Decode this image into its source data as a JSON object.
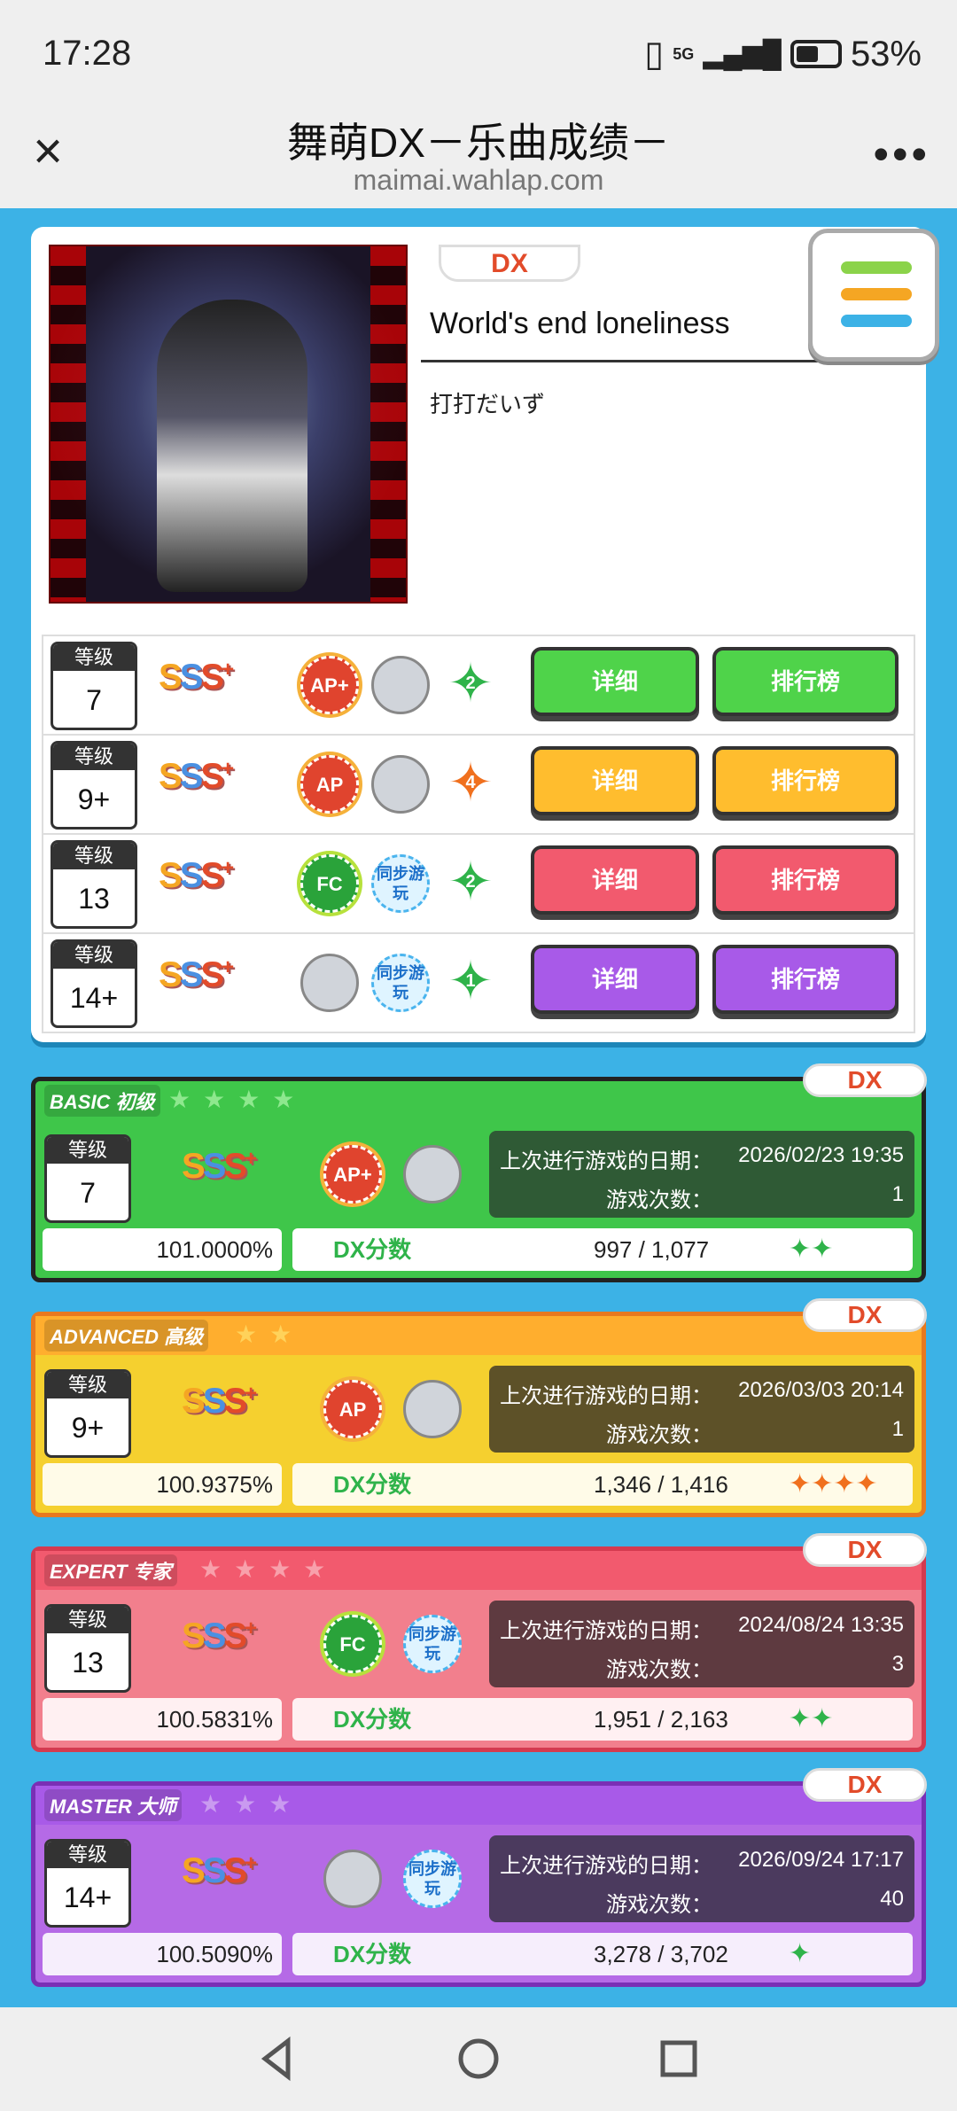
{
  "status": {
    "time": "17:28",
    "network": "5G",
    "battery": "53%"
  },
  "app": {
    "title": "舞萌DX－乐曲成绩－",
    "url": "maimai.wahlap.com"
  },
  "song": {
    "type_badge": "DX",
    "title": "World's end loneliness",
    "artist": "打打だいず"
  },
  "overview": [
    {
      "level_label": "等级",
      "level": "7",
      "rank": "SSS+",
      "combo": "AP+",
      "sync": "",
      "dx_stars": "2",
      "color": "#4fd34a",
      "detail_label": "详细",
      "ranking_label": "排行榜"
    },
    {
      "level_label": "等级",
      "level": "9+",
      "rank": "SSS+",
      "combo": "AP",
      "sync": "",
      "dx_stars": "4",
      "color": "#ffbd2e",
      "detail_label": "详细",
      "ranking_label": "排行榜"
    },
    {
      "level_label": "等级",
      "level": "13",
      "rank": "SSS+",
      "combo": "FC",
      "sync": "同步游玩",
      "dx_stars": "2",
      "color": "#f25a6e",
      "detail_label": "详细",
      "ranking_label": "排行榜"
    },
    {
      "level_label": "等级",
      "level": "14+",
      "rank": "SSS+",
      "combo": "",
      "sync": "同步游玩",
      "dx_stars": "1",
      "color": "#a85ae8",
      "detail_label": "详细",
      "ranking_label": "排行榜"
    }
  ],
  "cards": [
    {
      "difficulty": "BASIC 初级",
      "type_badge": "DX",
      "level_label": "等级",
      "level": "7",
      "rank": "SSS+",
      "combo": "AP+",
      "sync": "",
      "last_play_label": "上次进行游戏的日期：",
      "last_play": "2026/02/23 19:35",
      "play_count_label": "游戏次数：",
      "play_count": "1",
      "achievement": "101.0000%",
      "dx_score_label": "DX分数",
      "dx_score": "997 / 1,077",
      "dx_stars": "✦✦",
      "bg": "#3fc64a",
      "info_bg": "#2f5a35"
    },
    {
      "difficulty": "ADVANCED 高级",
      "type_badge": "DX",
      "level_label": "等级",
      "level": "9+",
      "rank": "SSS+",
      "combo": "AP",
      "sync": "",
      "last_play_label": "上次进行游戏的日期：",
      "last_play": "2026/03/03 20:14",
      "play_count_label": "游戏次数：",
      "play_count": "1",
      "achievement": "100.9375%",
      "dx_score_label": "DX分数",
      "dx_score": "1,346 / 1,416",
      "dx_stars": "✦✦✦✦",
      "bg": "#f5d02f",
      "info_bg": "#5d5128"
    },
    {
      "difficulty": "EXPERT 专家",
      "type_badge": "DX",
      "level_label": "等级",
      "level": "13",
      "rank": "SSS+",
      "combo": "FC",
      "sync": "同步游玩",
      "last_play_label": "上次进行游戏的日期：",
      "last_play": "2024/08/24 13:35",
      "play_count_label": "游戏次数：",
      "play_count": "3",
      "achievement": "100.5831%",
      "dx_score_label": "DX分数",
      "dx_score": "1,951 / 2,163",
      "dx_stars": "✦✦",
      "bg": "#f27f8d",
      "info_bg": "#5e3a40"
    },
    {
      "difficulty": "MASTER 大师",
      "type_badge": "DX",
      "level_label": "等级",
      "level": "14+",
      "rank": "SSS+",
      "combo": "",
      "sync": "同步游玩",
      "last_play_label": "上次进行游戏的日期：",
      "last_play": "2026/09/24 17:17",
      "play_count_label": "游戏次数：",
      "play_count": "40",
      "achievement": "100.5090%",
      "dx_score_label": "DX分数",
      "dx_score": "3,278 / 3,702",
      "dx_stars": "✦",
      "bg": "#b56ae6",
      "info_bg": "#4b3a5e"
    }
  ],
  "icons": {
    "close": "close-icon",
    "more": "more-icon",
    "menu": "hamburger-menu-icon",
    "back": "back-icon",
    "home": "home-icon",
    "recents": "recents-icon"
  }
}
